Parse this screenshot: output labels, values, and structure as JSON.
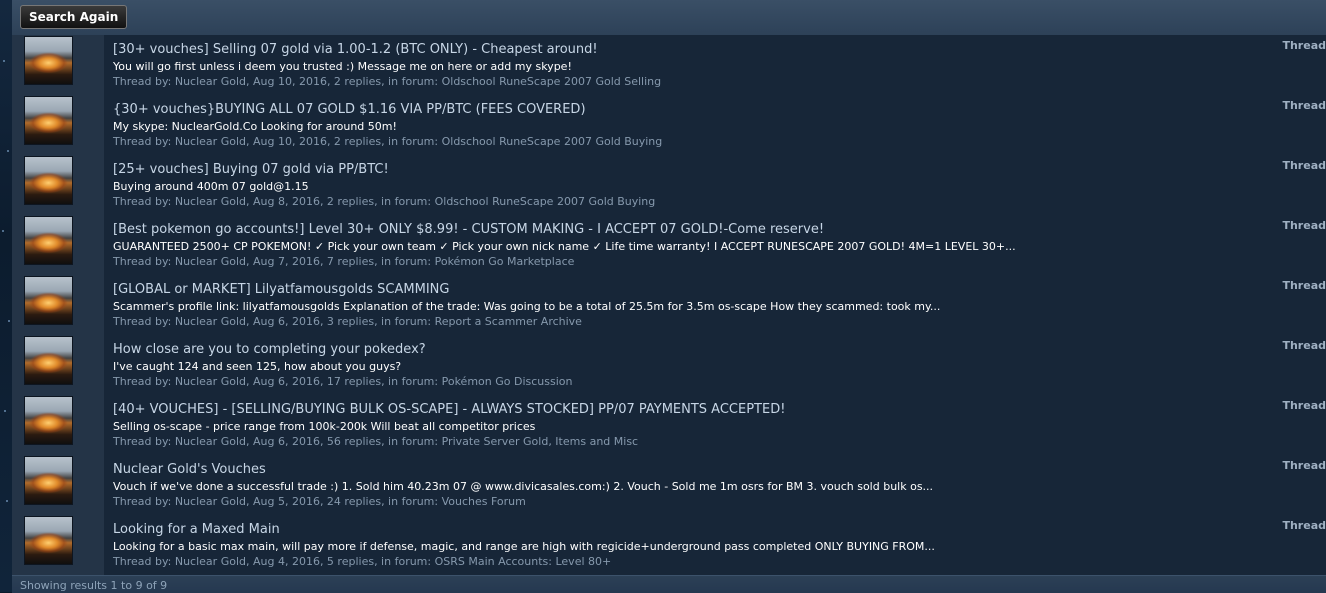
{
  "toolbar": {
    "search_again_label": "Search Again"
  },
  "results": [
    {
      "title": "[30+ vouches] Selling 07 gold via 1.00-1.2 (BTC ONLY) - Cheapest around!",
      "snippet": "You will go first unless i deem you trusted :) Message me on here or add my skype!",
      "meta_prefix": "Thread by: ",
      "author": "Nuclear Gold",
      "meta_mid": ", Aug 10, 2016, 2 replies, in forum: ",
      "forum": "Oldschool RuneScape 2007 Gold Selling",
      "type": "Thread"
    },
    {
      "title": "{30+ vouches}BUYING ALL 07 GOLD $1.16 VIA PP/BTC (FEES COVERED)",
      "snippet": "My skype: NuclearGold.Co Looking for around 50m!",
      "meta_prefix": "Thread by: ",
      "author": "Nuclear Gold",
      "meta_mid": ", Aug 10, 2016, 2 replies, in forum: ",
      "forum": "Oldschool RuneScape 2007 Gold Buying",
      "type": "Thread"
    },
    {
      "title": "[25+ vouches] Buying 07 gold via PP/BTC!",
      "snippet": "Buying around 400m 07 gold@1.15",
      "meta_prefix": "Thread by: ",
      "author": "Nuclear Gold",
      "meta_mid": ", Aug 8, 2016, 2 replies, in forum: ",
      "forum": "Oldschool RuneScape 2007 Gold Buying",
      "type": "Thread"
    },
    {
      "title": "[Best pokemon go accounts!] Level 30+ ONLY $8.99! - CUSTOM MAKING - I ACCEPT 07 GOLD!-Come reserve!",
      "snippet": "GUARANTEED 2500+ CP POKEMON! ✓ Pick your own team ✓ Pick your own nick name ✓ Life time warranty! I ACCEPT RUNESCAPE 2007 GOLD! 4M=1 LEVEL 30+...",
      "meta_prefix": "Thread by: ",
      "author": "Nuclear Gold",
      "meta_mid": ", Aug 7, 2016, 7 replies, in forum: ",
      "forum": "Pokémon Go Marketplace",
      "type": "Thread"
    },
    {
      "title": "[GLOBAL or MARKET] Lilyatfamousgolds SCAMMING",
      "snippet": "Scammer's profile link: lilyatfamousgolds Explanation of the trade: Was going to be a total of 25.5m for 3.5m os-scape How they scammed: took my...",
      "meta_prefix": "Thread by: ",
      "author": "Nuclear Gold",
      "meta_mid": ", Aug 6, 2016, 3 replies, in forum: ",
      "forum": "Report a Scammer Archive",
      "type": "Thread"
    },
    {
      "title": "How close are you to completing your pokedex?",
      "snippet": "I've caught 124 and seen 125, how about you guys?",
      "meta_prefix": "Thread by: ",
      "author": "Nuclear Gold",
      "meta_mid": ", Aug 6, 2016, 17 replies, in forum: ",
      "forum": "Pokémon Go Discussion",
      "type": "Thread"
    },
    {
      "title": "[40+ VOUCHES] - [SELLING/BUYING BULK OS-SCAPE] - ALWAYS STOCKED] PP/07 PAYMENTS ACCEPTED!",
      "snippet": "Selling os-scape - price range from 100k-200k Will beat all competitor prices",
      "meta_prefix": "Thread by: ",
      "author": "Nuclear Gold",
      "meta_mid": ", Aug 6, 2016, 56 replies, in forum: ",
      "forum": "Private Server Gold, Items and Misc",
      "type": "Thread"
    },
    {
      "title": "Nuclear Gold's Vouches",
      "snippet": "Vouch if we've done a successful trade :) 1. Sold him 40.23m 07 @ www.divicasales.com:) 2. Vouch - Sold me 1m osrs for BM 3. vouch sold bulk os...",
      "meta_prefix": "Thread by: ",
      "author": "Nuclear Gold",
      "meta_mid": ", Aug 5, 2016, 24 replies, in forum: ",
      "forum": "Vouches Forum",
      "type": "Thread"
    },
    {
      "title": "Looking for a Maxed Main",
      "snippet": "Looking for a basic max main, will pay more if defense, magic, and range are high with regicide+underground pass completed ONLY BUYING FROM...",
      "meta_prefix": "Thread by: ",
      "author": "Nuclear Gold",
      "meta_mid": ", Aug 4, 2016, 5 replies, in forum: ",
      "forum": "OSRS Main Accounts: Level 80+",
      "type": "Thread"
    }
  ],
  "footer": {
    "showing_text": "Showing results 1 to 9 of 9"
  }
}
